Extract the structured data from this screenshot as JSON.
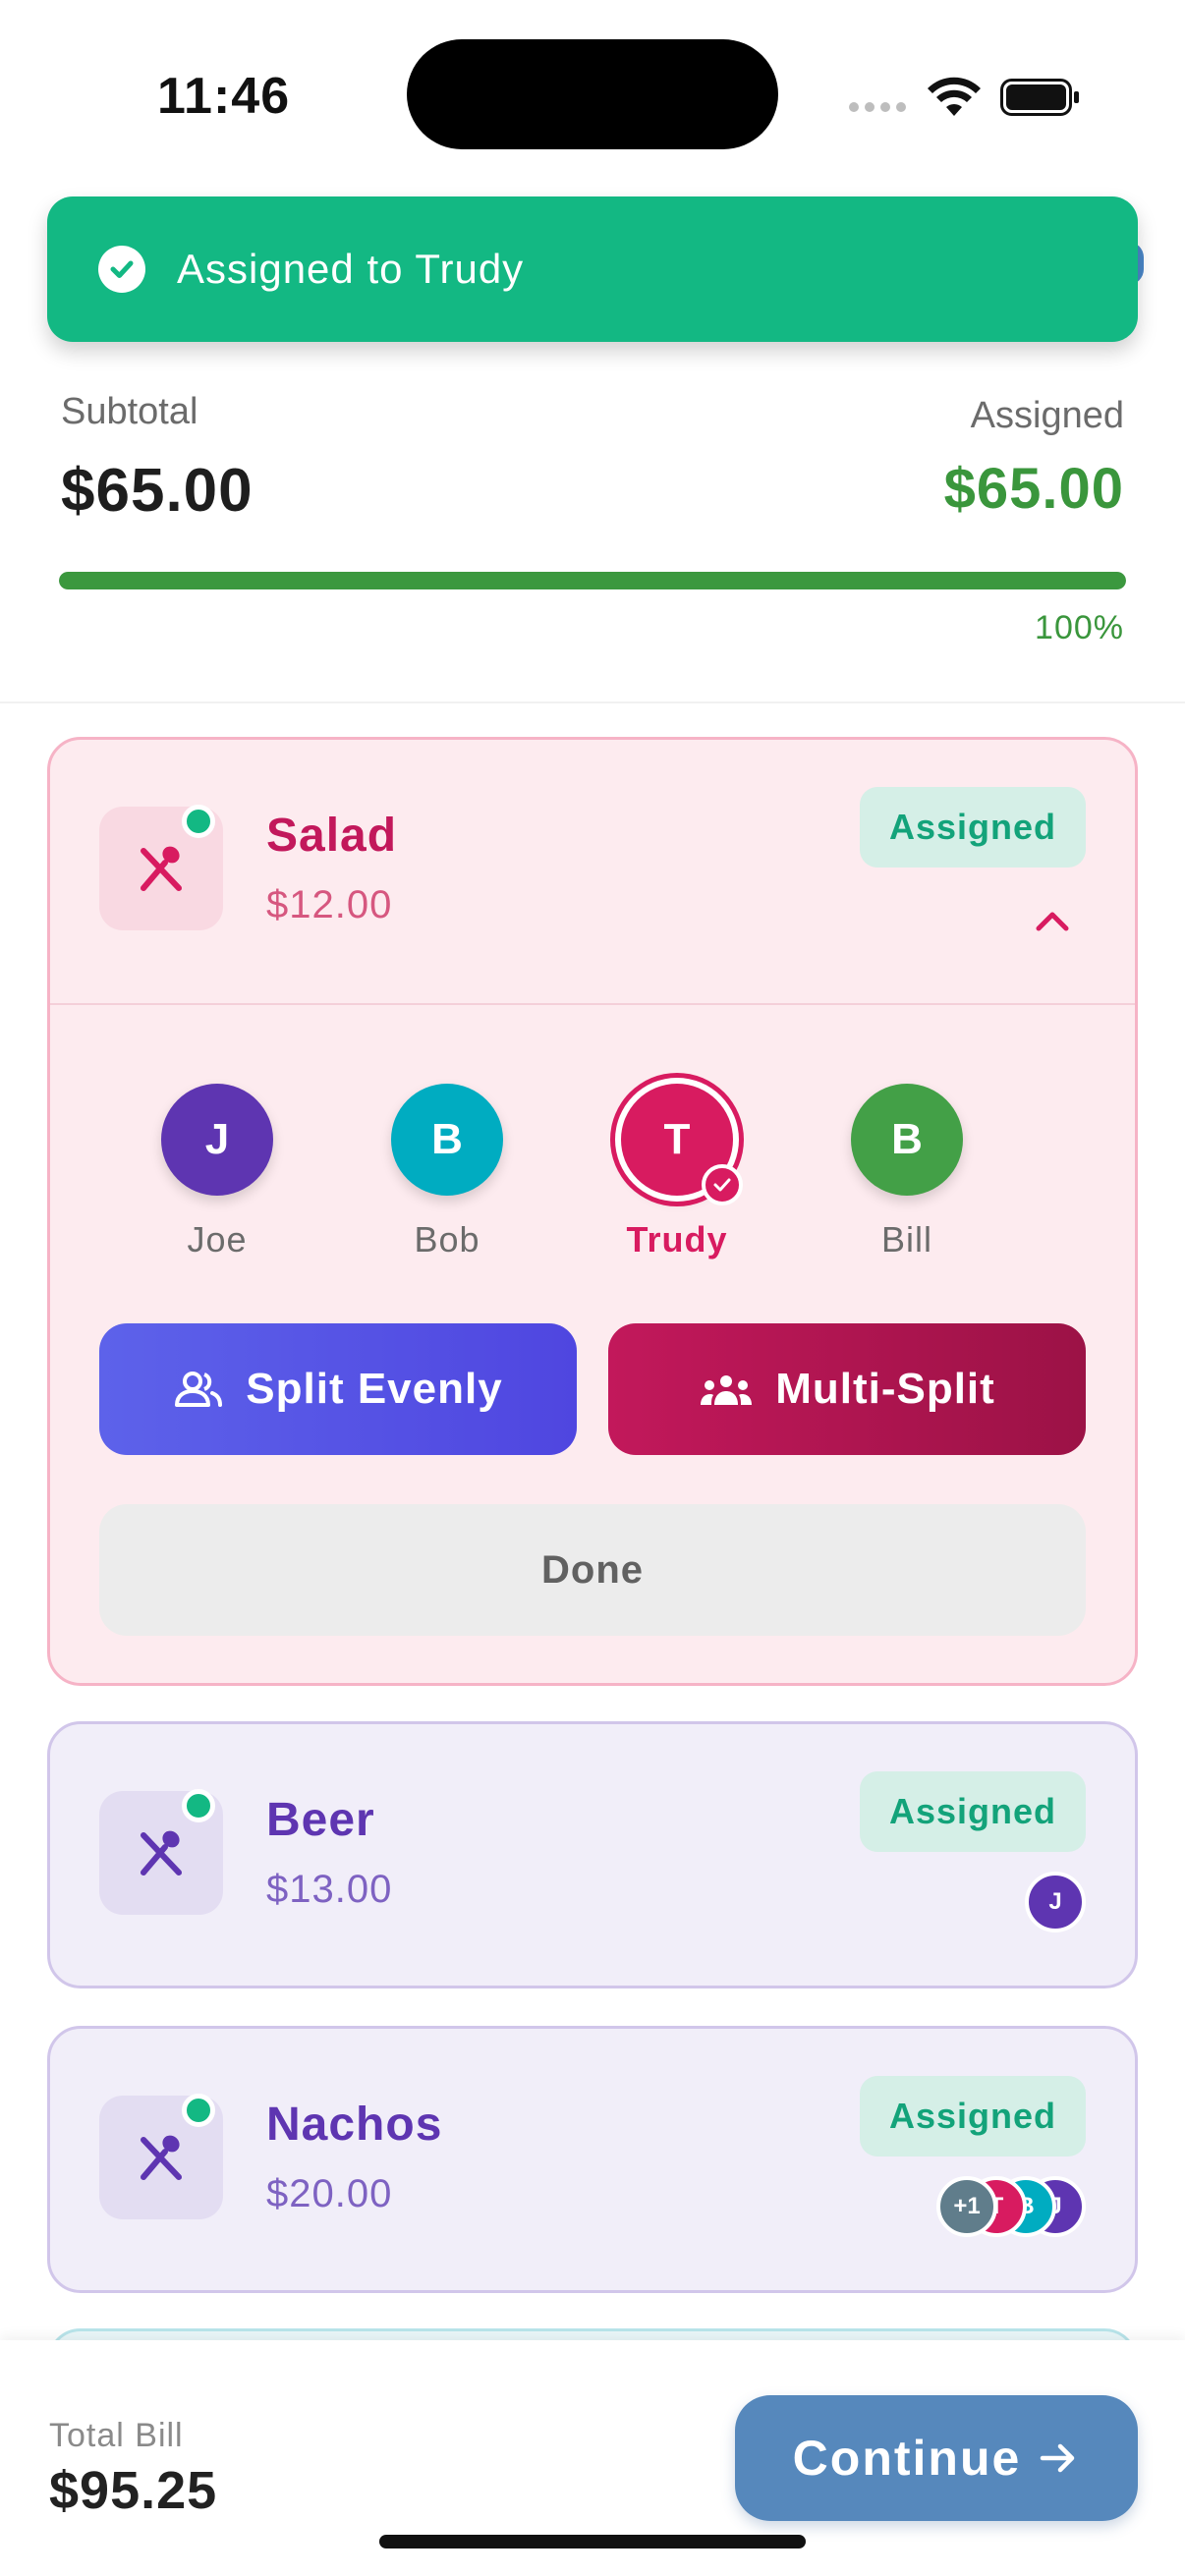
{
  "status_bar": {
    "time": "11:46"
  },
  "toast": {
    "text": "Assigned to Trudy"
  },
  "summary": {
    "subtotal_label": "Subtotal",
    "subtotal_value": "$65.00",
    "assigned_label": "Assigned",
    "assigned_value": "$65.00",
    "progress_percent": 100,
    "progress_text": "100%"
  },
  "items": [
    {
      "name": "Salad",
      "price": "$12.00",
      "badge": "Assigned",
      "expanded": true,
      "people": [
        {
          "initial": "J",
          "name": "Joe",
          "color": "#5e35b1",
          "selected": false
        },
        {
          "initial": "B",
          "name": "Bob",
          "color": "#00acc1",
          "selected": false
        },
        {
          "initial": "T",
          "name": "Trudy",
          "color": "#d81b60",
          "selected": true
        },
        {
          "initial": "B",
          "name": "Bill",
          "color": "#43a047",
          "selected": false
        }
      ],
      "split_evenly_label": "Split Evenly",
      "multi_split_label": "Multi-Split",
      "done_label": "Done"
    },
    {
      "name": "Beer",
      "price": "$13.00",
      "badge": "Assigned",
      "assignees": [
        {
          "initial": "J",
          "color": "#5e35b1"
        }
      ]
    },
    {
      "name": "Nachos",
      "price": "$20.00",
      "badge": "Assigned",
      "assignees": [
        {
          "initial": "+1",
          "color": "#607d8b"
        },
        {
          "initial": "T",
          "color": "#d81b60"
        },
        {
          "initial": "B",
          "color": "#00acc1"
        },
        {
          "initial": "J",
          "color": "#5e35b1"
        }
      ]
    }
  ],
  "footer": {
    "total_label": "Total Bill",
    "total_value": "$95.25",
    "continue_label": "Continue"
  },
  "colors": {
    "toast": "#13b883",
    "assigned_green": "#3a963c",
    "pink_accent": "#d81b60",
    "purple_accent": "#5e35b1",
    "continue": "#5688bc"
  }
}
